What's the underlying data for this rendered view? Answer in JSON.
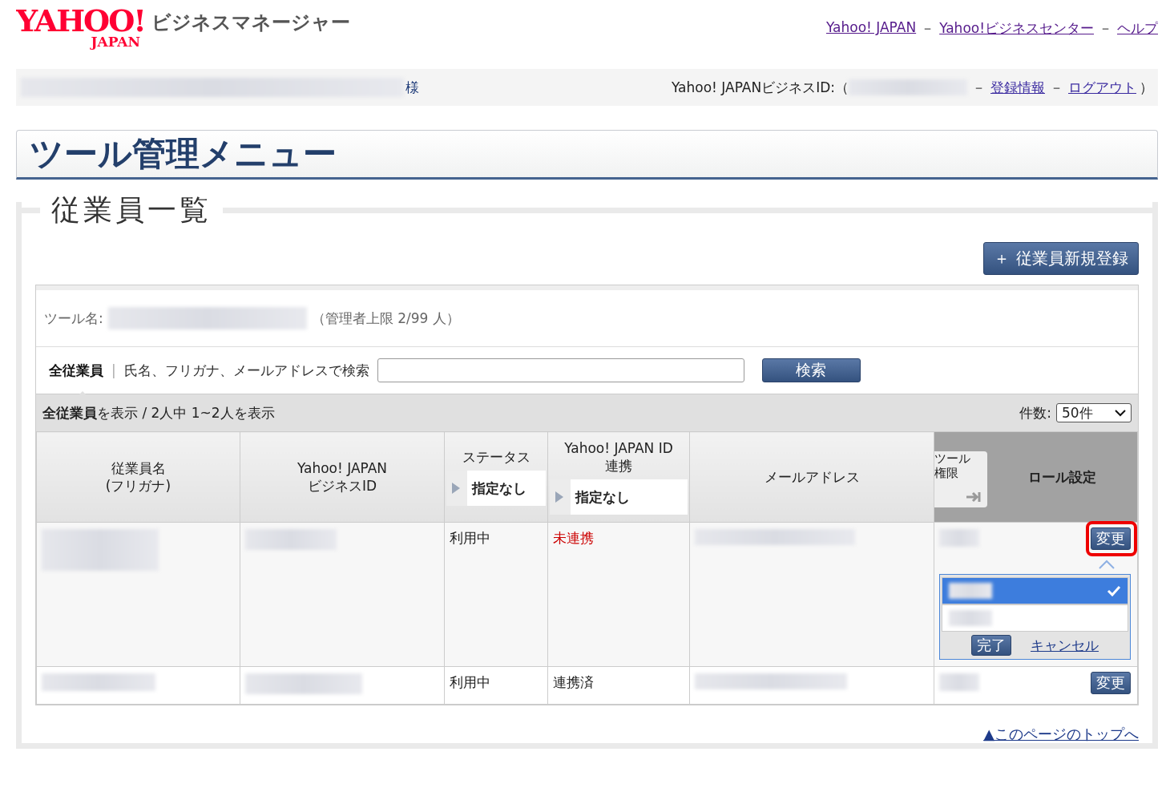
{
  "header": {
    "logo_main": "YAHOO!",
    "logo_sub": "JAPAN",
    "product": "ビジネスマネージャー",
    "links": [
      "Yahoo! JAPAN",
      "Yahoo!ビジネスセンター",
      "ヘルプ"
    ],
    "separator": "－"
  },
  "user_bar": {
    "honorific": "様",
    "id_label": "Yahoo! JAPANビジネスID:（",
    "links": [
      "登録情報",
      "ログアウト"
    ],
    "separator": "－",
    "close": "）"
  },
  "page_title": "ツール管理メニュー",
  "section_title": "従業員一覧",
  "add_button": {
    "icon": "＋",
    "label": "従業員新規登録"
  },
  "tool_line": {
    "label": "ツール名:",
    "limit": "（管理者上限 2/99 人）"
  },
  "search": {
    "tabs": [
      {
        "label": "全従業員",
        "selected": true
      },
      {
        "label": "氏名、フリガナ、メールアドレスで検索",
        "selected": false
      }
    ],
    "divider": "|",
    "button": "検索"
  },
  "summary": {
    "bold": "全従業員",
    "text": "を表示 / 2人中 1~2人を表示",
    "count_label": "件数:",
    "count_value": "50件"
  },
  "columns": [
    {
      "label": "従業員名\n(フリガナ)"
    },
    {
      "label": "Yahoo! JAPAN\nビジネスID"
    },
    {
      "label": "ステータス",
      "filter": "指定なし"
    },
    {
      "label": "Yahoo! JAPAN ID\n連携",
      "filter": "指定なし"
    },
    {
      "label": "メールアドレス"
    },
    {
      "label": "ロール設定",
      "side_tab": [
        "ツール",
        "権限"
      ]
    }
  ],
  "rows": [
    {
      "status": "利用中",
      "link": "未連携",
      "linked": false,
      "button": "変更",
      "highlighted": true,
      "menu": {
        "options": [
          {
            "selected": true
          },
          {
            "selected": false
          }
        ],
        "done": "完了",
        "cancel": "キャンセル"
      }
    },
    {
      "status": "利用中",
      "link": "連携済",
      "linked": true,
      "button": "変更",
      "highlighted": false
    }
  ],
  "footer_link": "▲このページのトップへ"
}
